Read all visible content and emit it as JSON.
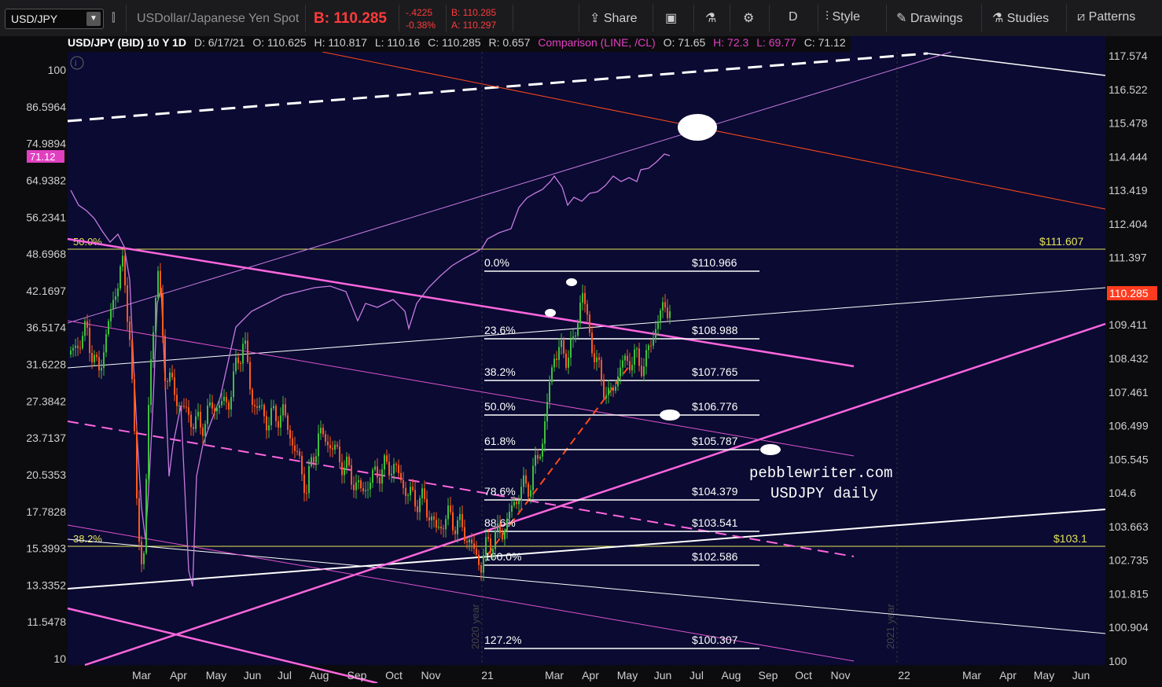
{
  "toolbar": {
    "symbol": "USD/JPY",
    "description": "USDollar/Japanese Yen Spot",
    "bid_label": "B: 110.285",
    "change": "-.4225",
    "change_pct": "-0.38%",
    "bid_small": "B: 110.285",
    "ask_small": "A: 110.297",
    "share_label": "Share",
    "timeframe_label": "D",
    "style_label": "Style",
    "drawings_label": "Drawings",
    "studies_label": "Studies",
    "patterns_label": "Patterns"
  },
  "header": {
    "title": "USD/JPY (BID) 10 Y 1D",
    "date": "D: 6/17/21",
    "open": "O: 110.625",
    "high": "H: 110.817",
    "low": "L: 110.16",
    "close": "C: 110.285",
    "range": "R: 0.657",
    "comparison": "Comparison (LINE, /CL)",
    "cmp_open": "O: 71.65",
    "cmp_high": "H: 72.3",
    "cmp_low": "L: 69.77",
    "cmp_close": "C: 71.12"
  },
  "chart_data": {
    "type": "candlestick",
    "colors": {
      "up": "#3fbf3f",
      "down": "#ff5a1f",
      "comparison": "#c77be0",
      "fib": "#ffffff",
      "pink": "#ff66dd",
      "orange": "#ff4a1a",
      "yellow": "#e5e55a",
      "last_price_box": "#ff3b1f",
      "comparison_box": "#e040c0"
    },
    "x_ticks": [
      "Mar",
      "Apr",
      "May",
      "Jun",
      "Jul",
      "Aug",
      "Sep",
      "Oct",
      "Nov",
      "21",
      "Mar",
      "Apr",
      "May",
      "Jun",
      "Jul",
      "Aug",
      "Sep",
      "Oct",
      "Nov",
      "22",
      "Mar",
      "Apr",
      "May",
      "Jun"
    ],
    "right_axis_ticks": [
      "117.574",
      "116.522",
      "115.478",
      "114.444",
      "113.419",
      "112.404",
      "111.397",
      "110.2",
      "109.411",
      "108.432",
      "107.461",
      "106.499",
      "105.545",
      "104.6",
      "103.663",
      "102.735",
      "101.815",
      "100.904",
      "100"
    ],
    "left_axis_ticks": [
      "100",
      "86.5964",
      "74.9894",
      "64.9382",
      "56.2341",
      "48.6968",
      "42.1697",
      "36.5174",
      "31.6228",
      "27.3842",
      "23.7137",
      "20.5353",
      "17.7828",
      "15.3993",
      "13.3352",
      "11.5478",
      "10"
    ],
    "last_price": "110.285",
    "comparison_last": "71.12",
    "year_markers": [
      "2020 year",
      "2021 year"
    ],
    "fib_levels": [
      {
        "pct": "0.0%",
        "price": "$110.966"
      },
      {
        "pct": "23.6%",
        "price": "$108.988"
      },
      {
        "pct": "38.2%",
        "price": "$107.765"
      },
      {
        "pct": "50.0%",
        "price": "$106.776"
      },
      {
        "pct": "61.8%",
        "price": "$105.787"
      },
      {
        "pct": "78.6%",
        "price": "$104.379"
      },
      {
        "pct": "88.6%",
        "price": "$103.541"
      },
      {
        "pct": "100.0%",
        "price": "$102.586"
      },
      {
        "pct": "127.2%",
        "price": "$100.307"
      }
    ],
    "horizontal_levels": [
      {
        "label_left": "50.0%",
        "label_right": "$111.607"
      },
      {
        "label_left": "38.2%",
        "label_right": "$103.1"
      }
    ],
    "annotation_lines": [
      "pebblewriter.com",
      "USDJPY daily"
    ]
  }
}
